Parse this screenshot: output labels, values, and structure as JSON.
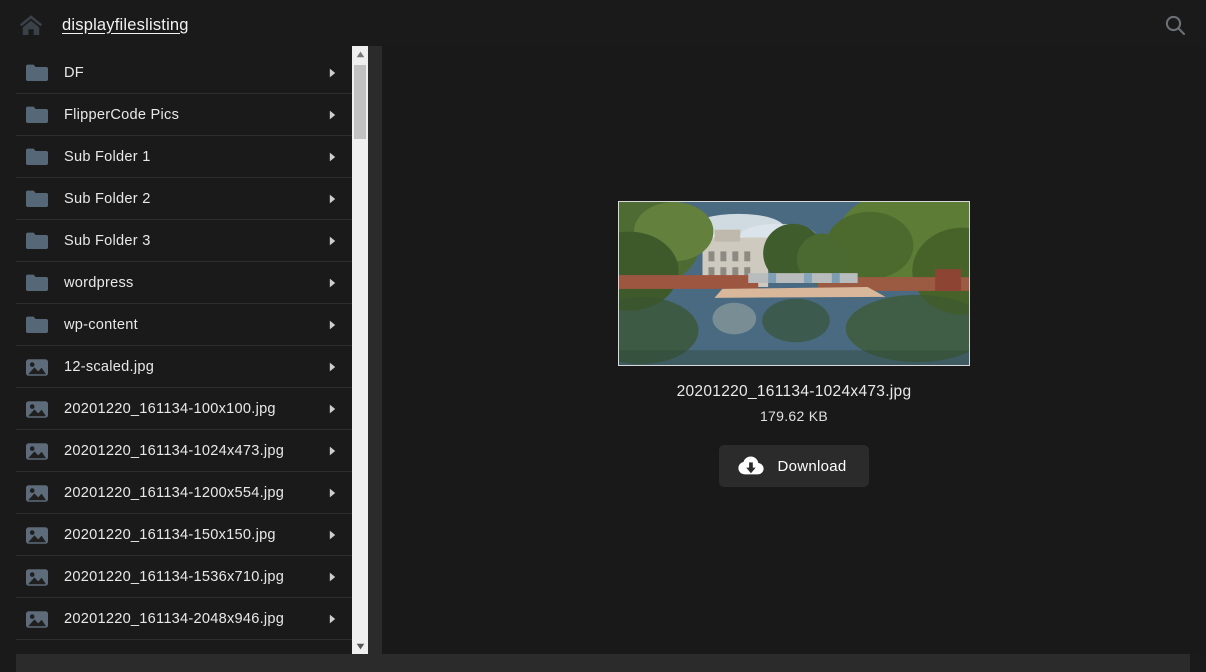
{
  "header": {
    "home_icon": "home-icon",
    "breadcrumb": "displayfileslisting",
    "search_icon": "search-icon"
  },
  "sidebar": {
    "items": [
      {
        "label": "DF",
        "type": "folder",
        "icon": "folder-icon",
        "arrow": "chevron-right-icon"
      },
      {
        "label": "FlipperCode Pics",
        "type": "folder",
        "icon": "folder-icon",
        "arrow": "chevron-right-icon"
      },
      {
        "label": "Sub Folder 1",
        "type": "folder",
        "icon": "folder-icon",
        "arrow": "chevron-right-icon"
      },
      {
        "label": "Sub Folder 2",
        "type": "folder",
        "icon": "folder-icon",
        "arrow": "chevron-right-icon"
      },
      {
        "label": "Sub Folder 3",
        "type": "folder",
        "icon": "folder-icon",
        "arrow": "chevron-right-icon"
      },
      {
        "label": "wordpress",
        "type": "folder",
        "icon": "folder-icon",
        "arrow": "chevron-right-icon"
      },
      {
        "label": "wp-content",
        "type": "folder",
        "icon": "folder-icon",
        "arrow": "chevron-right-icon"
      },
      {
        "label": "12-scaled.jpg",
        "type": "image",
        "icon": "image-file-icon",
        "arrow": "chevron-right-icon"
      },
      {
        "label": "20201220_161134-100x100.jpg",
        "type": "image",
        "icon": "image-file-icon",
        "arrow": "chevron-right-icon"
      },
      {
        "label": "20201220_161134-1024x473.jpg",
        "type": "image",
        "icon": "image-file-icon",
        "arrow": "chevron-right-icon"
      },
      {
        "label": "20201220_161134-1200x554.jpg",
        "type": "image",
        "icon": "image-file-icon",
        "arrow": "chevron-right-icon"
      },
      {
        "label": "20201220_161134-150x150.jpg",
        "type": "image",
        "icon": "image-file-icon",
        "arrow": "chevron-right-icon"
      },
      {
        "label": "20201220_161134-1536x710.jpg",
        "type": "image",
        "icon": "image-file-icon",
        "arrow": "chevron-right-icon"
      },
      {
        "label": "20201220_161134-2048x946.jpg",
        "type": "image",
        "icon": "image-file-icon",
        "arrow": "chevron-right-icon"
      }
    ],
    "scrollbar": {
      "up_arrow_icon": "scroll-up-arrow-icon",
      "down_arrow_icon": "scroll-down-arrow-icon"
    }
  },
  "preview": {
    "image_alt": "park-pond-photo-preview",
    "file_name": "20201220_161134-1024x473.jpg",
    "file_size": "179.62 KB",
    "download_label": "Download",
    "download_icon": "cloud-download-icon"
  },
  "colors": {
    "page_background": "#1a1a1a",
    "panel_background": "#191919",
    "row_divider": "#2e2e2e",
    "folder_icon": "#566878",
    "file_icon": "#5d6b7a",
    "text_primary": "#e8e8e8",
    "button_background": "#2b2b2b",
    "scrollbar_track": "#efefef",
    "scrollbar_thumb": "#c1c1c1"
  }
}
